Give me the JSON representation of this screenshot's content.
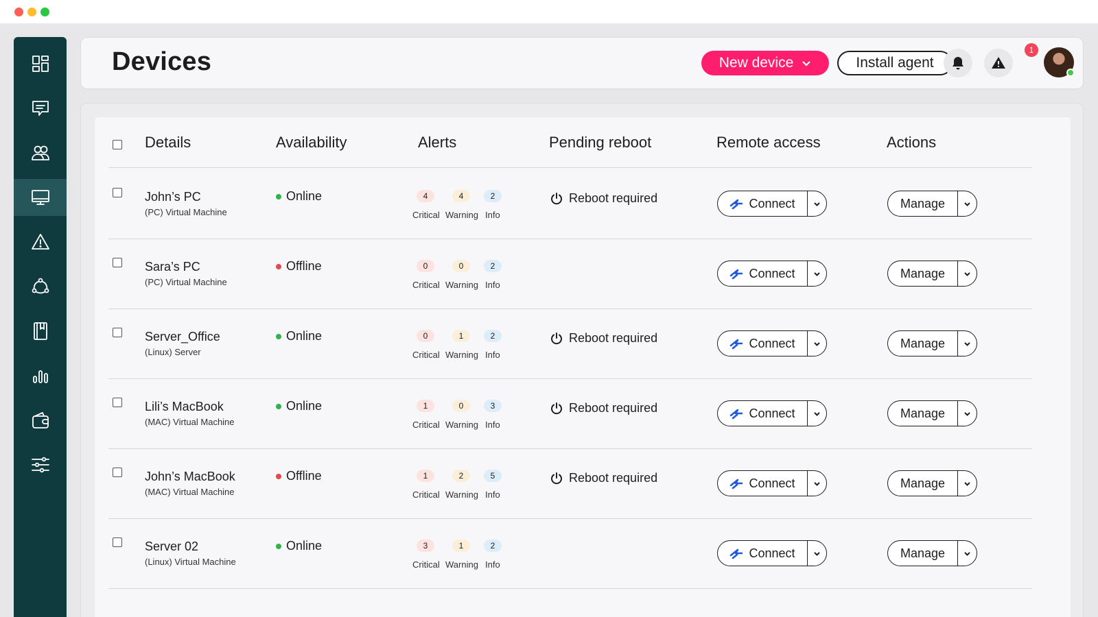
{
  "app": {
    "page_title": "Devices",
    "new_device_label": "New device",
    "install_agent_label": "Install agent",
    "alert_badge_count": "1"
  },
  "sidebar": {
    "items": [
      {
        "icon": "dashboard-icon"
      },
      {
        "icon": "chat-icon"
      },
      {
        "icon": "users-icon"
      },
      {
        "icon": "monitor-icon",
        "active": true
      },
      {
        "icon": "warning-icon"
      },
      {
        "icon": "network-icon"
      },
      {
        "icon": "book-icon"
      },
      {
        "icon": "chart-icon"
      },
      {
        "icon": "wallet-icon"
      },
      {
        "icon": "settings-sliders-icon"
      }
    ]
  },
  "table": {
    "headers": {
      "details": "Details",
      "availability": "Availability",
      "alerts": "Alerts",
      "pending_reboot": "Pending reboot",
      "remote_access": "Remote access",
      "actions": "Actions"
    },
    "alert_labels": {
      "critical": "Critical",
      "warning": "Warning",
      "info": "Info"
    },
    "connect_label": "Connect",
    "manage_label": "Manage",
    "reboot_label": "Reboot required",
    "rows": [
      {
        "name": "John’s PC",
        "type": "(PC) Virtual Machine",
        "status": "Online",
        "status_color": "#2fb34a",
        "critical": "4",
        "warning": "4",
        "info": "2",
        "reboot": true
      },
      {
        "name": "Sara’s PC",
        "type": "(PC) Virtual Machine",
        "status": "Offline",
        "status_color": "#e5484d",
        "critical": "0",
        "warning": "0",
        "info": "2",
        "reboot": false
      },
      {
        "name": "Server_Office",
        "type": "(Linux) Server",
        "status": "Online",
        "status_color": "#2fb34a",
        "critical": "0",
        "warning": "1",
        "info": "2",
        "reboot": true
      },
      {
        "name": "Lili’s MacBook",
        "type": "(MAC) Virtual Machine",
        "status": "Online",
        "status_color": "#2fb34a",
        "critical": "1",
        "warning": "0",
        "info": "3",
        "reboot": true
      },
      {
        "name": "John’s MacBook",
        "type": "(MAC) Virtual Machine",
        "status": "Offline",
        "status_color": "#e5484d",
        "critical": "1",
        "warning": "2",
        "info": "5",
        "reboot": true
      },
      {
        "name": "Server 02",
        "type": "(Linux) Virtual Machine",
        "status": "Online",
        "status_color": "#2fb34a",
        "critical": "3",
        "warning": "1",
        "info": "2",
        "reboot": false
      }
    ]
  },
  "colors": {
    "sidebar_bg": "#0f3b3f",
    "accent_pink": "#ff1e6e",
    "online": "#2fb34a",
    "offline": "#e5484d"
  }
}
